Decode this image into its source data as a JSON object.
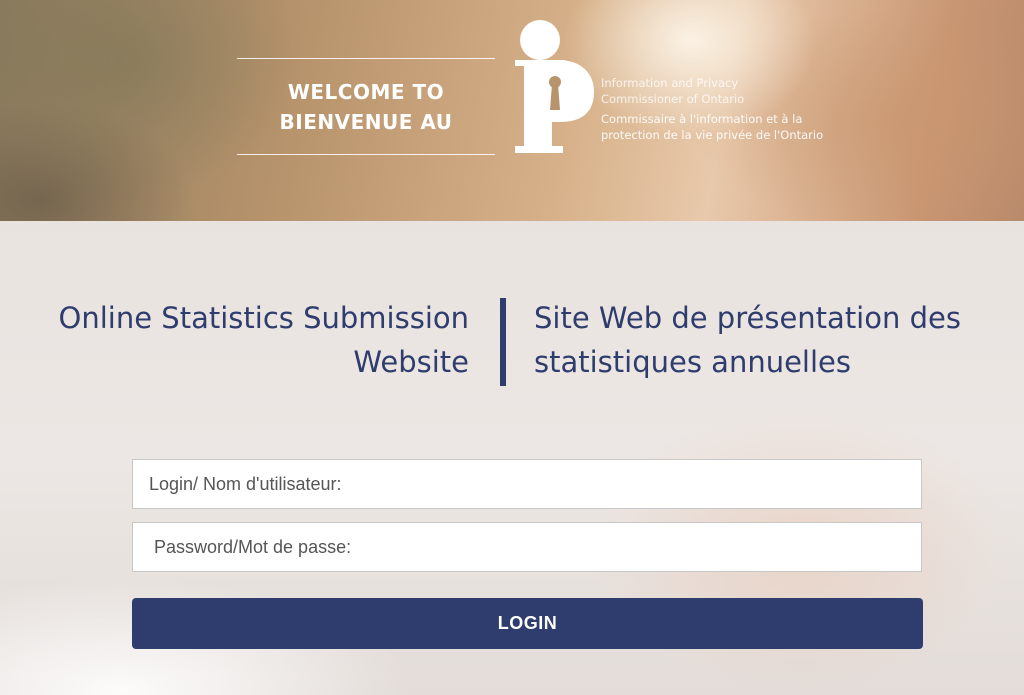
{
  "banner": {
    "welcome_line1": "WELCOME TO",
    "welcome_line2": "BIENVENUE AU",
    "logo_icon": "ipc-keyhole-logo-icon",
    "org_name_en": [
      "Information and Privacy",
      "Commissioner of Ontario"
    ],
    "org_name_fr": [
      "Commissaire à l'information et à la",
      "protection de la vie privée de l'Ontario"
    ]
  },
  "headings": {
    "en_line1": "Online Statistics Submission",
    "en_line2": "Website",
    "fr_line1": "Site Web de présentation des",
    "fr_line2": "statistiques annuelles"
  },
  "form": {
    "login_placeholder": "Login/ Nom d'utilisateur:",
    "login_value": "",
    "password_placeholder": "Password/Mot de passe:",
    "password_value": "",
    "submit_label": "LOGIN"
  },
  "colors": {
    "brand_navy": "#2f3c6e",
    "button_navy": "#2e3d6d",
    "logo_white": "#ffffff"
  }
}
